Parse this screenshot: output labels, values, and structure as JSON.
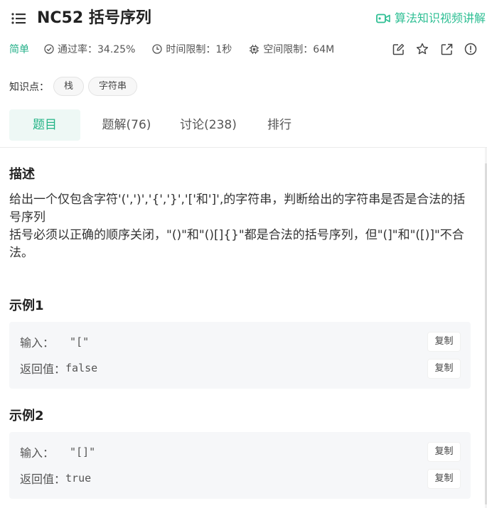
{
  "header": {
    "title": "NC52  括号序列",
    "video_link": "算法知识视频讲解"
  },
  "meta": {
    "difficulty": "简单",
    "pass_rate": "通过率：34.25%",
    "time_limit": "时间限制：1秒",
    "memory_limit": "空间限制：64M"
  },
  "tags": {
    "label": "知识点：",
    "items": [
      "栈",
      "字符串"
    ]
  },
  "tabs": [
    "题目",
    "题解(76)",
    "讨论(238)",
    "排行"
  ],
  "description": {
    "heading": "描述",
    "line1": "给出一个仅包含字符'(',')','{','}','['和']',的字符串，判断给出的字符串是否是合法的括号序列",
    "line2": "括号必须以正确的顺序关闭，\"()\"和\"()[]{}\"都是合法的括号序列，但\"(]\"和\"([)]\"不合法。"
  },
  "examples": [
    {
      "heading": "示例1",
      "input_label": "输入：",
      "input_value": "\"[\"",
      "output_label": "返回值：",
      "output_value": "false",
      "copy_label": "复制"
    },
    {
      "heading": "示例2",
      "input_label": "输入：",
      "input_value": "\"[]\"",
      "output_label": "返回值：",
      "output_value": "true",
      "copy_label": "复制"
    }
  ],
  "colors": {
    "accent": "#23b386",
    "tab_active_bg": "#eef8f5",
    "example_bg": "#f6f7f9"
  },
  "icons": {
    "menu": "list-icon",
    "video": "video-camera-icon",
    "pass_rate": "check-circle-icon",
    "time": "clock-icon",
    "memory": "chip-icon",
    "actions": [
      "edit-icon",
      "star-icon",
      "external-link-icon",
      "info-icon"
    ]
  }
}
